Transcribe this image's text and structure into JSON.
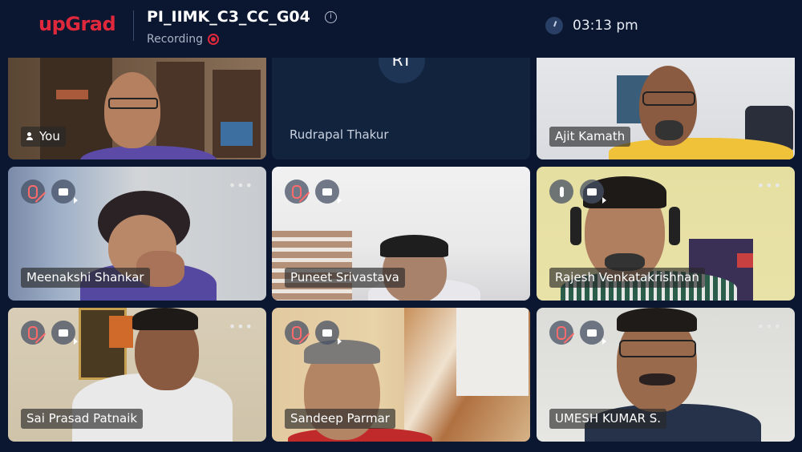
{
  "header": {
    "logo": "upGrad",
    "meeting_title": "PI_IIMK_C3_CC_G04",
    "recording_label": "Recording",
    "time": "03:13 pm"
  },
  "participants": [
    {
      "name": "You",
      "video": true
    },
    {
      "name": "Rudrapal Thakur",
      "initials": "RT",
      "video": false
    },
    {
      "name": "Ajit Kamath",
      "video": true
    },
    {
      "name": "Meenakshi Shankar",
      "video": true
    },
    {
      "name": "Puneet Srivastava",
      "video": true
    },
    {
      "name": "Rajesh Venkatakrishnan",
      "video": true
    },
    {
      "name": "Sai Prasad Patnaik",
      "video": true
    },
    {
      "name": "Sandeep Parmar",
      "video": true
    },
    {
      "name": "UMESH KUMAR S.",
      "video": true
    }
  ],
  "tile_more_label": "•••",
  "colors": {
    "brand": "#e0283c",
    "background": "#0b1730"
  }
}
